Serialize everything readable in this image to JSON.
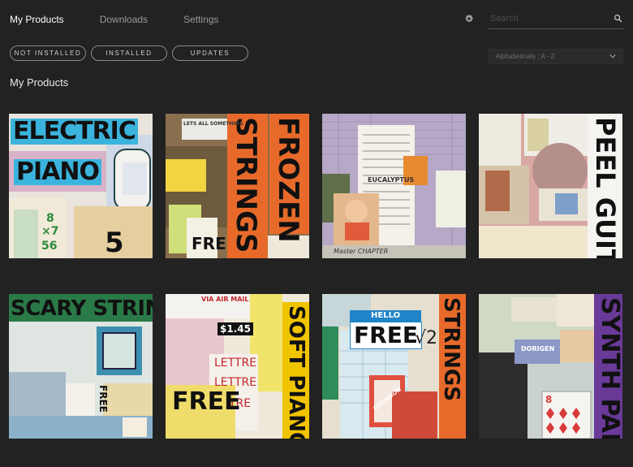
{
  "nav": {
    "tabs": [
      {
        "label": "My Products",
        "active": true
      },
      {
        "label": "Downloads",
        "active": false
      },
      {
        "label": "Settings",
        "active": false
      }
    ]
  },
  "search": {
    "placeholder": "Search"
  },
  "filters": {
    "pills": [
      "NOT INSTALLED",
      "INSTALLED",
      "UPDATES"
    ]
  },
  "sort": {
    "selected": "Alphabetically : A - Z"
  },
  "section": {
    "title": "My Products"
  },
  "products": [
    {
      "line1": "ELECTRIC",
      "line2": "PIANO",
      "extra1": "8",
      "extra2": "×7",
      "extra3": "56",
      "extra4": "5"
    },
    {
      "line1": "STRINGS",
      "line2": "FROZEN",
      "extra1": "FRE",
      "extra2": "LETS ALL SOMETHING"
    },
    {
      "line1": "EUCALYPTUS",
      "line2": "Master CHAPTER"
    },
    {
      "line1": "PEEL GUITAR"
    },
    {
      "line1": "SCARY STRINGS",
      "extra1": "FREE"
    },
    {
      "line1": "SOFT PIANO",
      "line2": "FREE",
      "extra1": "VIA AIR MAIL",
      "extra2": "$1.45",
      "extra3": "LETTRE",
      "extra4": "LETTRE",
      "extra5": "TRE"
    },
    {
      "line1": "STRINGS",
      "line2": "FREE",
      "extra1": "HELLO",
      "extra2": "OCCASION",
      "extra3": "√2"
    },
    {
      "line1": "SYNTH PADS",
      "extra1": "8",
      "extra2": "DORIGEN"
    }
  ],
  "colors": {
    "background": "#222223",
    "pill_border": "#8a8a8a",
    "active_tab": "#ffffff",
    "inactive_tab": "#9a9a9a"
  }
}
